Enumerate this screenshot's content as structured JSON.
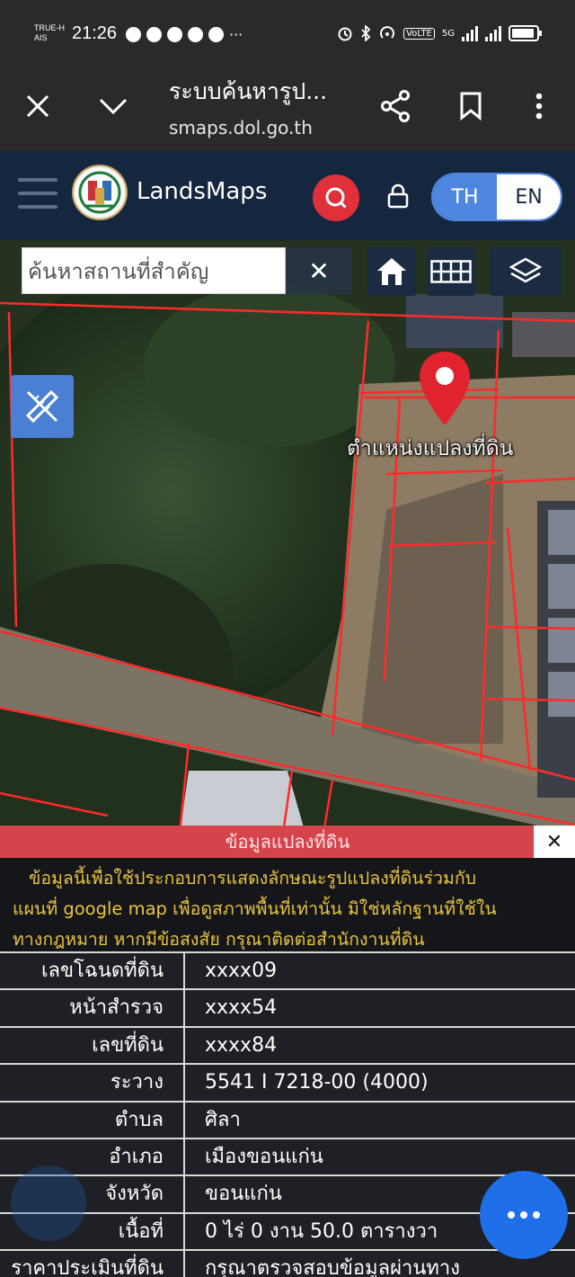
{
  "status_bar": {
    "carrier_line1": "TRUE-H",
    "carrier_line2": "AIS",
    "time": "21:26",
    "notification_icons": [
      "messenger-icon",
      "facebook-icon",
      "instagram-icon",
      "shopee-icon",
      "line-icon"
    ],
    "more": "···",
    "volte": "VoLTE",
    "network": "5G"
  },
  "browser": {
    "title": "ระบบค้นหารูป...",
    "url": "smaps.dol.go.th"
  },
  "app": {
    "brand": "LandsMaps",
    "lang_th": "TH",
    "lang_en": "EN"
  },
  "map": {
    "search_placeholder": "ค้นหาสถานที่สำคัญ",
    "clear": "✕",
    "pin_label": "ตำแหน่งแปลงที่ดิน"
  },
  "panel": {
    "title": "ข้อมูลแปลงที่ดิน",
    "close": "✕",
    "notice_lines": [
      "ข้อมูลนี้เพื่อใช้ประกอบการแสดงลักษณะรูปแปลงที่ดินร่วมกับ",
      "แผนที่ google map เพื่อดูสภาพพื้นที่เท่านั้น มิใช่หลักฐานที่ใช้ใน",
      "ทางกฎหมาย หากมีข้อสงสัย กรุณาติดต่อสำนักงานที่ดิน"
    ],
    "rows": [
      {
        "label": "เลขโฉนดที่ดิน",
        "value": "xxxx09"
      },
      {
        "label": "หน้าสำรวจ",
        "value": "xxxx54"
      },
      {
        "label": "เลขที่ดิน",
        "value": "xxxx84"
      },
      {
        "label": "ระวาง",
        "value": "5541 I 7218-00 (4000)"
      },
      {
        "label": "ตำบล",
        "value": "ศิลา"
      },
      {
        "label": "อำเภอ",
        "value": "เมืองขอนแก่น"
      },
      {
        "label": "จังหวัด",
        "value": "ขอนแก่น"
      },
      {
        "label": "เนื้อที่",
        "value": "0 ไร่ 0 งาน 50.0 ตารางวา"
      },
      {
        "label": "ราคาประเมินที่ดิน",
        "value": "กรุณาตรวจสอบข้อมูลผ่านทาง"
      }
    ]
  },
  "colors": {
    "header_bg": "#15273f",
    "accent_red": "#e0303a",
    "accent_blue": "#4f86e0",
    "parcel_line": "#ff2a2a",
    "notice_text": "#e9c43e"
  }
}
